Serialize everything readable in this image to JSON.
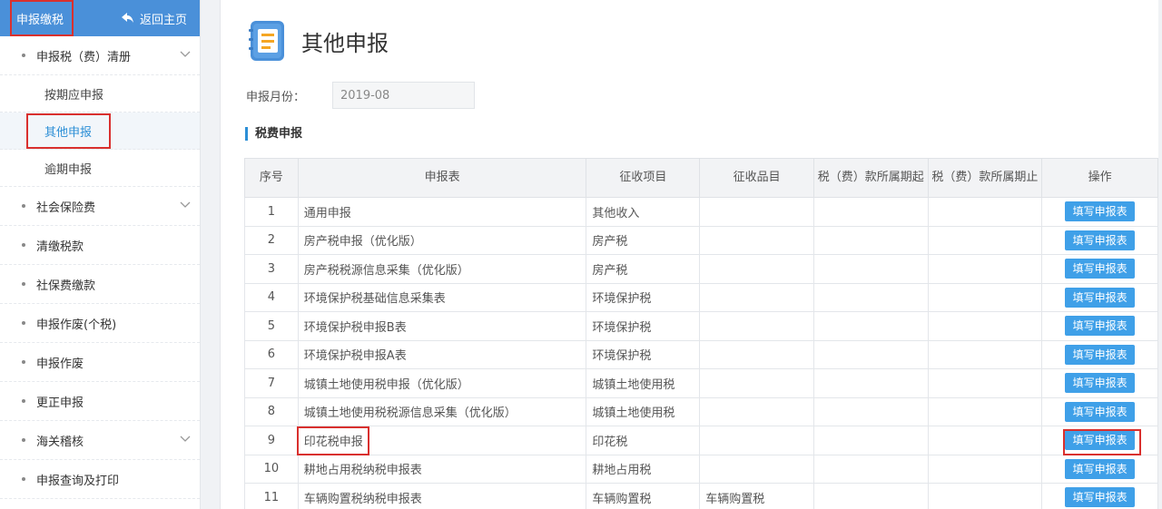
{
  "sidebar": {
    "title": "申报缴税",
    "home_label": "返回主页",
    "items": [
      {
        "label": "申报税（费）清册",
        "expandable": true
      },
      {
        "label": "社会保险费",
        "expandable": true
      },
      {
        "label": "清缴税款",
        "expandable": false
      },
      {
        "label": "社保费缴款",
        "expandable": false
      },
      {
        "label": "申报作废(个税)",
        "expandable": false
      },
      {
        "label": "申报作废",
        "expandable": false
      },
      {
        "label": "更正申报",
        "expandable": false
      },
      {
        "label": "海关稽核",
        "expandable": true
      },
      {
        "label": "申报查询及打印",
        "expandable": false
      }
    ],
    "sub_items": [
      "按期应申报",
      "其他申报",
      "逾期申报"
    ],
    "active_sub_item": "其他申报"
  },
  "main": {
    "title": "其他申报",
    "month_label": "申报月份：",
    "month_value": "2019-08",
    "section_title": "税费申报"
  },
  "table": {
    "headers": [
      "序号",
      "申报表",
      "征收项目",
      "征收品目",
      "税（费）款所属期起",
      "税（费）款所属期止",
      "操作"
    ],
    "button_label": "填写申报表",
    "rows": [
      {
        "no": "1",
        "form": "通用申报",
        "project": "其他收入",
        "item": ""
      },
      {
        "no": "2",
        "form": "房产税申报（优化版）",
        "project": "房产税",
        "item": ""
      },
      {
        "no": "3",
        "form": "房产税税源信息采集（优化版）",
        "project": "房产税",
        "item": ""
      },
      {
        "no": "4",
        "form": "环境保护税基础信息采集表",
        "project": "环境保护税",
        "item": ""
      },
      {
        "no": "5",
        "form": "环境保护税申报B表",
        "project": "环境保护税",
        "item": ""
      },
      {
        "no": "6",
        "form": "环境保护税申报A表",
        "project": "环境保护税",
        "item": ""
      },
      {
        "no": "7",
        "form": "城镇土地使用税申报（优化版）",
        "project": "城镇土地使用税",
        "item": ""
      },
      {
        "no": "8",
        "form": "城镇土地使用税税源信息采集（优化版）",
        "project": "城镇土地使用税",
        "item": ""
      },
      {
        "no": "9",
        "form": "印花税申报",
        "project": "印花税",
        "item": ""
      },
      {
        "no": "10",
        "form": "耕地占用税纳税申报表",
        "project": "耕地占用税",
        "item": ""
      },
      {
        "no": "11",
        "form": "车辆购置税纳税申报表",
        "project": "车辆购置税",
        "item": "车辆购置税"
      }
    ]
  },
  "colors": {
    "accent": "#2c8fd6",
    "header_bar": "#4a90d9",
    "button": "#3fa0e8",
    "highlight": "#d9302e"
  }
}
